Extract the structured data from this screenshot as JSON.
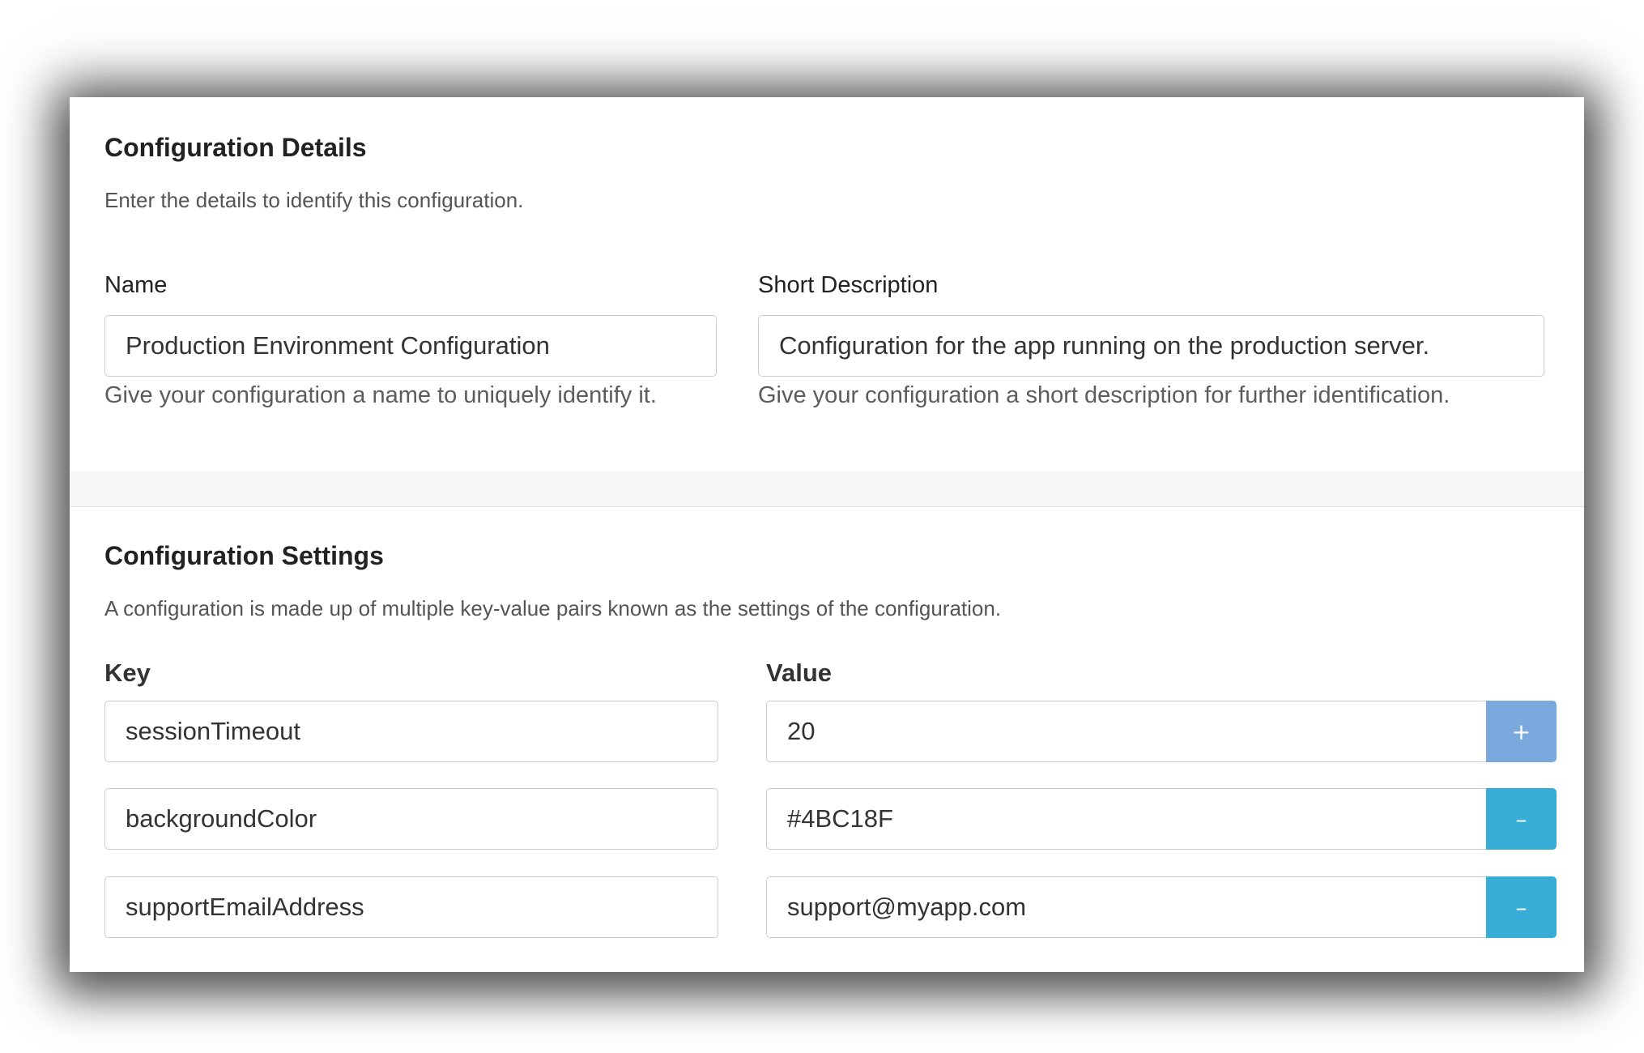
{
  "details": {
    "title": "Configuration Details",
    "description": "Enter the details to identify this configuration.",
    "name_label": "Name",
    "name_value": "Production Environment Configuration",
    "name_help": "Give your configuration a name to uniquely identify it.",
    "short_desc_label": "Short Description",
    "short_desc_value": "Configuration for the app running on the production server.",
    "short_desc_help": "Give your configuration a short description for further identification."
  },
  "settings": {
    "title": "Configuration Settings",
    "description": "A configuration is made up of multiple key-value pairs known as the settings of the configuration.",
    "key_header": "Key",
    "value_header": "Value",
    "rows": [
      {
        "key": "sessionTimeout",
        "value": "20",
        "button": "+"
      },
      {
        "key": "backgroundColor",
        "value": "#4BC18F",
        "button": "–"
      },
      {
        "key": "supportEmailAddress",
        "value": "support@myapp.com",
        "button": "–"
      }
    ]
  },
  "colors": {
    "add_button": "#7aa9dd",
    "remove_button": "#36acd7"
  }
}
